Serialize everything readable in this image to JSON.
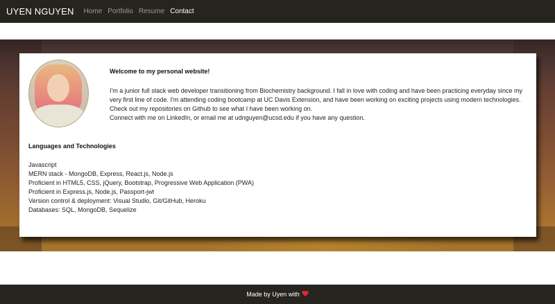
{
  "navbar": {
    "brand": "UYEN NGUYEN",
    "links": [
      {
        "label": "Home"
      },
      {
        "label": "Portfolio"
      },
      {
        "label": "Resume"
      },
      {
        "label": "Contact"
      }
    ],
    "active": "Contact"
  },
  "profile": {
    "avatar": "profile-photo",
    "welcome": "Welcome to my personal website!",
    "bio": [
      "I'm a junior full stack web developer transitioning from Biochemistry background. I fall in love with coding and have been practicing everyday since my very first line of code. I'm attending coding bootcamp at UC Davis Extension, and have been working on exciting projects using modern technologies.",
      "Check out my repositories on Github to see what I have been working on.",
      "Connect with me on LinkedIn, or email me at udnguyen@ucsd.edu if you have any question."
    ]
  },
  "languages": {
    "title": "Languages and Technologies",
    "items": [
      "Javascript",
      "MERN stack - MongoDB, Express, React.js, Node.js",
      "Proficient in HTML5, CSS, jQuery, Bootstrap, Progressive Web Application (PWA)",
      "Proficient in Express.js, Node.js, Passport-jwt",
      "Version control & deployment: Visual Studio, Git/GitHub, Heroku",
      "Databases: SQL, MongoDB, Sequelize"
    ]
  },
  "footer": {
    "text": "Made by Uyen with",
    "icon": "heart-icon"
  },
  "colors": {
    "nav_bg": "#26241f",
    "footer_bg": "#26241f",
    "heart": "#e3262d"
  }
}
